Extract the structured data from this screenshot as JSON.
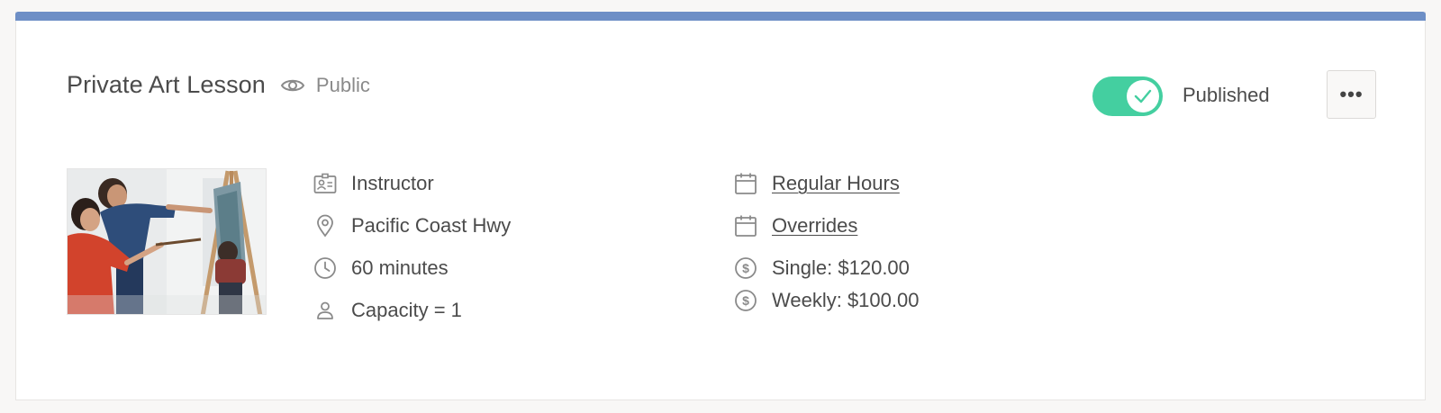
{
  "listing": {
    "title": "Private Art Lesson",
    "visibility": "Public",
    "published": true,
    "status_label": "Published",
    "more_label": "•••",
    "accent_color": "#6e8fc6",
    "toggle_color": "#44cfa0"
  },
  "details": {
    "left": [
      {
        "icon": "id-card-icon",
        "text": "Instructor"
      },
      {
        "icon": "location-pin-icon",
        "text": "Pacific Coast Hwy"
      },
      {
        "icon": "clock-icon",
        "text": "60 minutes"
      },
      {
        "icon": "person-icon",
        "text": "Capacity = 1"
      }
    ],
    "right": [
      {
        "icon": "calendar-icon",
        "text": "Regular Hours"
      },
      {
        "icon": "calendar-icon",
        "text": "Overrides"
      },
      {
        "icon": "dollar-circle-icon",
        "text": "Single: $120.00"
      },
      {
        "icon": "dollar-circle-icon",
        "text": "Weekly: $100.00"
      }
    ]
  }
}
